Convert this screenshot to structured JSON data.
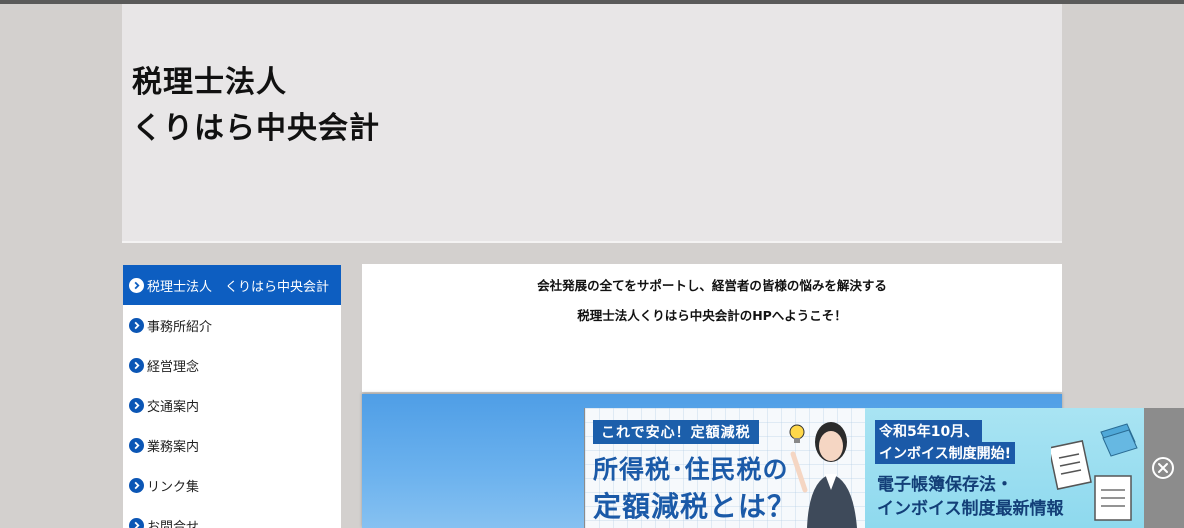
{
  "header": {
    "title_line1": "税理士法人",
    "title_line2": "くりはら中央会計"
  },
  "sidebar": {
    "items": [
      {
        "label": "税理士法人　くりはら中央会計",
        "active": true
      },
      {
        "label": "事務所紹介",
        "active": false
      },
      {
        "label": "経営理念",
        "active": false
      },
      {
        "label": "交通案内",
        "active": false
      },
      {
        "label": "業務案内",
        "active": false
      },
      {
        "label": "リンク集",
        "active": false
      },
      {
        "label": "お問合せ",
        "active": false
      }
    ],
    "icon": "chevron-right-circle-icon"
  },
  "main": {
    "line1": "会社発展の全てをサポートし、経営者の皆様の悩みを解決する",
    "line2": "税理士法人くりはら中央会計のHPへようこそ！"
  },
  "ad": {
    "tag": "これで安心！定額減税",
    "headline1": "所得税･住民税の",
    "headline2": "定額減税とは？",
    "badge1": "令和5年10月、",
    "badge2": "インボイス制度開始!",
    "info1": "電子帳簿保存法・",
    "info2": "インボイス制度最新情報",
    "close_icon": "close-circle-icon"
  },
  "colors": {
    "accent": "#0d5ec1",
    "page_bg": "#d3d0ce",
    "header_bg": "#e8e6e7"
  }
}
